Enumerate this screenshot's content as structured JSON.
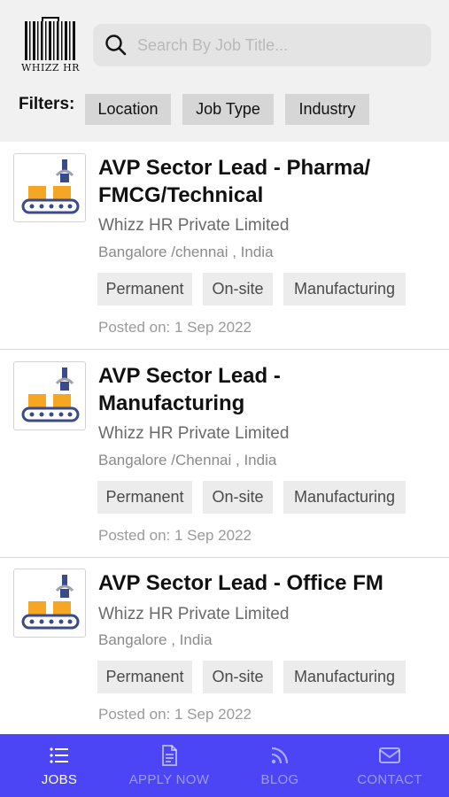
{
  "header": {
    "logo_text": "WHIZZ HR",
    "search": {
      "placeholder": "Search By Job Title...",
      "value": ""
    },
    "filters_label": "Filters:",
    "filters": [
      "Location",
      "Job Type",
      "Industry"
    ]
  },
  "jobs": [
    {
      "title_line1": "AVP Sector Lead - Pharma/",
      "title_line2": "FMCG/Technical",
      "company": "Whizz HR Private Limited",
      "location": "Bangalore /chennai , India",
      "tags": [
        "Permanent",
        "On-site",
        "Manufacturing"
      ],
      "posted": "Posted on: 1 Sep 2022"
    },
    {
      "title_line1": "AVP Sector Lead -",
      "title_line2": "Manufacturing",
      "company": "Whizz HR Private Limited",
      "location": "Bangalore /Chennai , India",
      "tags": [
        "Permanent",
        "On-site",
        "Manufacturing"
      ],
      "posted": "Posted on: 1 Sep 2022"
    },
    {
      "title_line1": "AVP Sector Lead - Office FM",
      "title_line2": "",
      "company": "Whizz HR Private Limited",
      "location": "Bangalore , India",
      "tags": [
        "Permanent",
        "On-site",
        "Manufacturing"
      ],
      "posted": "Posted on: 1 Sep 2022"
    }
  ],
  "bottom_nav": {
    "items": [
      {
        "label": "JOBS",
        "icon": "list-icon",
        "active": true
      },
      {
        "label": "APPLY NOW",
        "icon": "document-icon",
        "active": false
      },
      {
        "label": "BLOG",
        "icon": "rss-icon",
        "active": false
      },
      {
        "label": "CONTACT",
        "icon": "mail-icon",
        "active": false
      }
    ],
    "background": "#4b45f5"
  }
}
